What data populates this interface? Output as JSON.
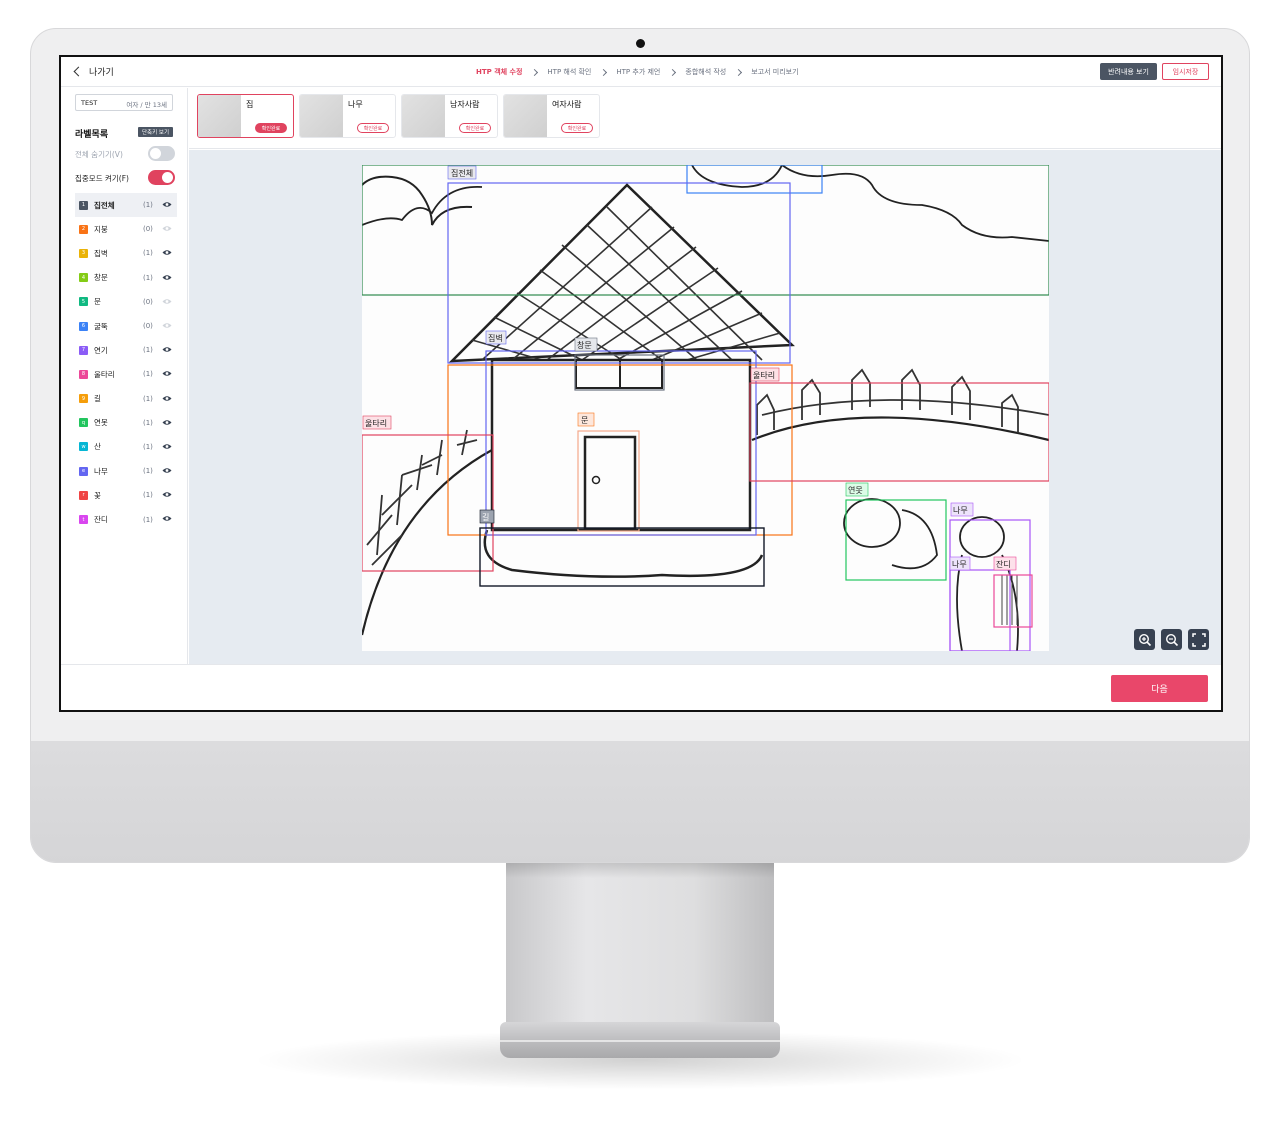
{
  "header": {
    "back_label": "나가기",
    "steps": [
      {
        "label": "HTP 객체 수정",
        "active": true
      },
      {
        "label": "HTP 해석 확인",
        "active": false
      },
      {
        "label": "HTP 추가 제언",
        "active": false
      },
      {
        "label": "종합해석 작성",
        "active": false
      },
      {
        "label": "보고서 미리보기",
        "active": false
      }
    ],
    "view_rejection_label": "반려내용 보기",
    "temp_save_label": "임시저장"
  },
  "sidebar": {
    "user_name": "TEST",
    "user_info": "여자 / 만 13세",
    "labels_title": "라벨목록",
    "shortcut_label": "단축키 보기",
    "hide_all_label": "전체 숨기기(V)",
    "hide_all_on": false,
    "focus_mode_label": "집중모드 켜기(F)",
    "focus_mode_on": true,
    "labels": [
      {
        "key": "1",
        "name": "집전체",
        "count": "(1)",
        "color": "#4b5563",
        "visible": true,
        "selected": true
      },
      {
        "key": "2",
        "name": "지붕",
        "count": "(0)",
        "color": "#f97316",
        "visible": false
      },
      {
        "key": "3",
        "name": "집벽",
        "count": "(1)",
        "color": "#eab308",
        "visible": true
      },
      {
        "key": "4",
        "name": "창문",
        "count": "(1)",
        "color": "#84cc16",
        "visible": true
      },
      {
        "key": "5",
        "name": "문",
        "count": "(0)",
        "color": "#10b981",
        "visible": false
      },
      {
        "key": "6",
        "name": "굴뚝",
        "count": "(0)",
        "color": "#3b82f6",
        "visible": false
      },
      {
        "key": "7",
        "name": "연기",
        "count": "(1)",
        "color": "#8b5cf6",
        "visible": true
      },
      {
        "key": "8",
        "name": "울타리",
        "count": "(1)",
        "color": "#ec4899",
        "visible": true
      },
      {
        "key": "9",
        "name": "길",
        "count": "(1)",
        "color": "#f59e0b",
        "visible": true
      },
      {
        "key": "q",
        "name": "연못",
        "count": "(1)",
        "color": "#22c55e",
        "visible": true
      },
      {
        "key": "w",
        "name": "산",
        "count": "(1)",
        "color": "#06b6d4",
        "visible": true
      },
      {
        "key": "e",
        "name": "나무",
        "count": "(1)",
        "color": "#6366f1",
        "visible": true
      },
      {
        "key": "r",
        "name": "꽃",
        "count": "(1)",
        "color": "#ef4444",
        "visible": true
      },
      {
        "key": "t",
        "name": "잔디",
        "count": "(1)",
        "color": "#d946ef",
        "visible": true
      }
    ]
  },
  "thumbnails": [
    {
      "name": "집",
      "badge": "확인완료",
      "selected": true
    },
    {
      "name": "나무",
      "badge": "확인완료",
      "selected": false
    },
    {
      "name": "남자사람",
      "badge": "확인완료",
      "selected": false
    },
    {
      "name": "여자사람",
      "badge": "확인완료",
      "selected": false
    }
  ],
  "canvas": {
    "boxes": [
      {
        "label": "집전체",
        "color": "#e0435f"
      },
      {
        "label": "집벽",
        "color": "#6366f1"
      },
      {
        "label": "창문",
        "color": "#6b7280"
      },
      {
        "label": "울타리",
        "color": "#e0435f"
      },
      {
        "label": "울타리",
        "color": "#e0435f"
      },
      {
        "label": "문",
        "color": "#f97316"
      },
      {
        "label": "길",
        "color": "#111827"
      },
      {
        "label": "연못",
        "color": "#22c55e"
      },
      {
        "label": "나무",
        "color": "#a855f7"
      },
      {
        "label": "나무",
        "color": "#a855f7"
      },
      {
        "label": "잔디",
        "color": "#ec4899"
      }
    ]
  },
  "footer": {
    "next_label": "다음"
  },
  "colors": {
    "accent": "#e0435f",
    "dark": "#4b5563"
  }
}
